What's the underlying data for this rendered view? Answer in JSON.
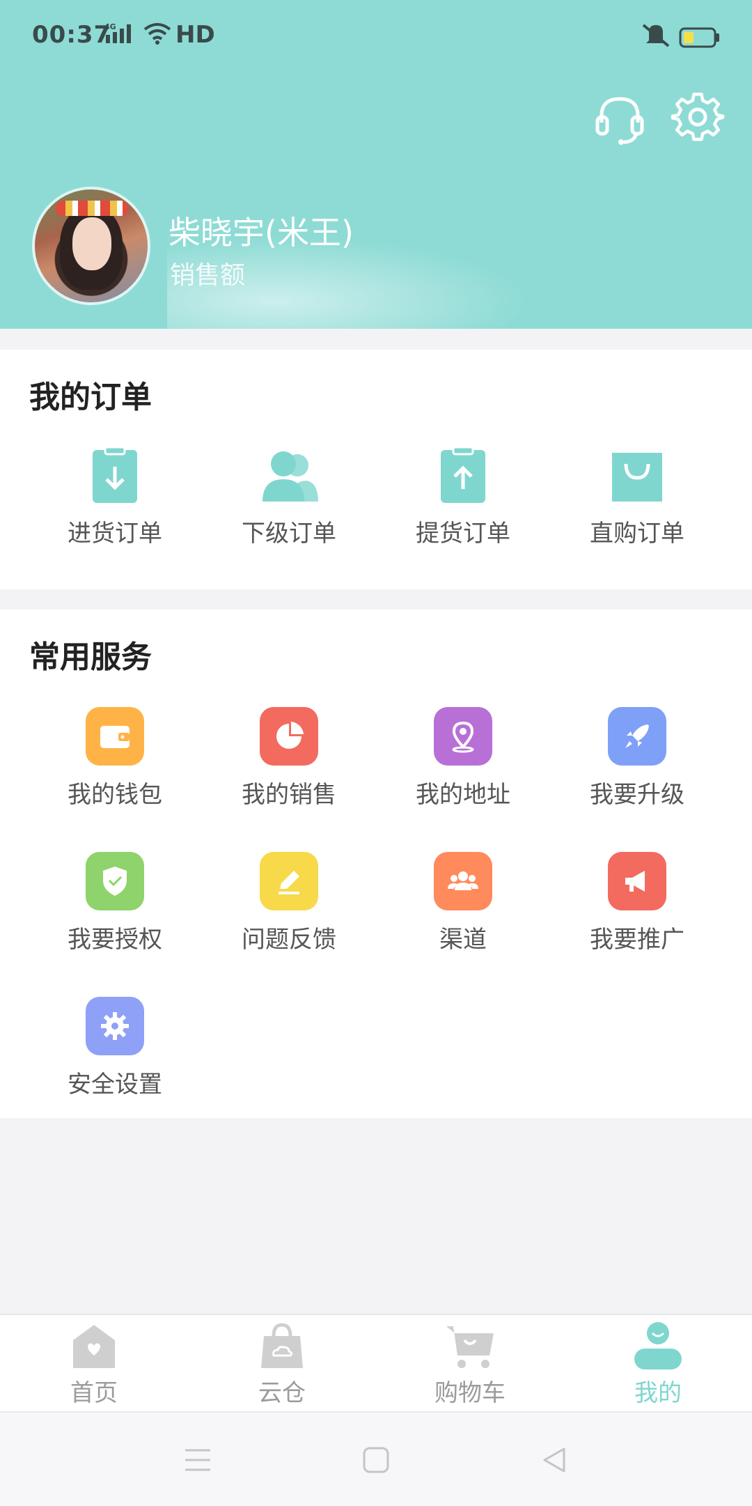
{
  "status_bar": {
    "time": "00:37",
    "network": "4G",
    "hd": "HD"
  },
  "profile": {
    "name": "柴晓宇(米王)",
    "sales_label": "销售额"
  },
  "orders": {
    "title": "我的订单",
    "items": [
      {
        "label": "进货订单",
        "icon": "clipboard-download-icon"
      },
      {
        "label": "下级订单",
        "icon": "users-icon"
      },
      {
        "label": "提货订单",
        "icon": "clipboard-upload-icon"
      },
      {
        "label": "直购订单",
        "icon": "shopping-bag-icon"
      }
    ]
  },
  "services": {
    "title": "常用服务",
    "items": [
      {
        "label": "我的钱包",
        "icon": "wallet-icon",
        "color": "#ffb347"
      },
      {
        "label": "我的销售",
        "icon": "pie-chart-icon",
        "color": "#f26b5e"
      },
      {
        "label": "我的地址",
        "icon": "location-icon",
        "color": "#b86fd6"
      },
      {
        "label": "我要升级",
        "icon": "rocket-icon",
        "color": "#7fa0f7"
      },
      {
        "label": "我要授权",
        "icon": "shield-check-icon",
        "color": "#8ed36b"
      },
      {
        "label": "问题反馈",
        "icon": "edit-icon",
        "color": "#f7d94a"
      },
      {
        "label": "渠道",
        "icon": "group-icon",
        "color": "#ff8a5c"
      },
      {
        "label": "我要推广",
        "icon": "megaphone-icon",
        "color": "#f26b5e"
      },
      {
        "label": "安全设置",
        "icon": "gear-icon",
        "color": "#8fa0f7"
      }
    ]
  },
  "tabbar": {
    "items": [
      {
        "label": "首页",
        "icon": "home-icon",
        "active": false
      },
      {
        "label": "云仓",
        "icon": "cloud-bag-icon",
        "active": false
      },
      {
        "label": "购物车",
        "icon": "cart-icon",
        "active": false
      },
      {
        "label": "我的",
        "icon": "profile-icon",
        "active": true
      }
    ]
  },
  "colors": {
    "accent": "#8edbd5",
    "tab_active": "#7fd6cf"
  }
}
